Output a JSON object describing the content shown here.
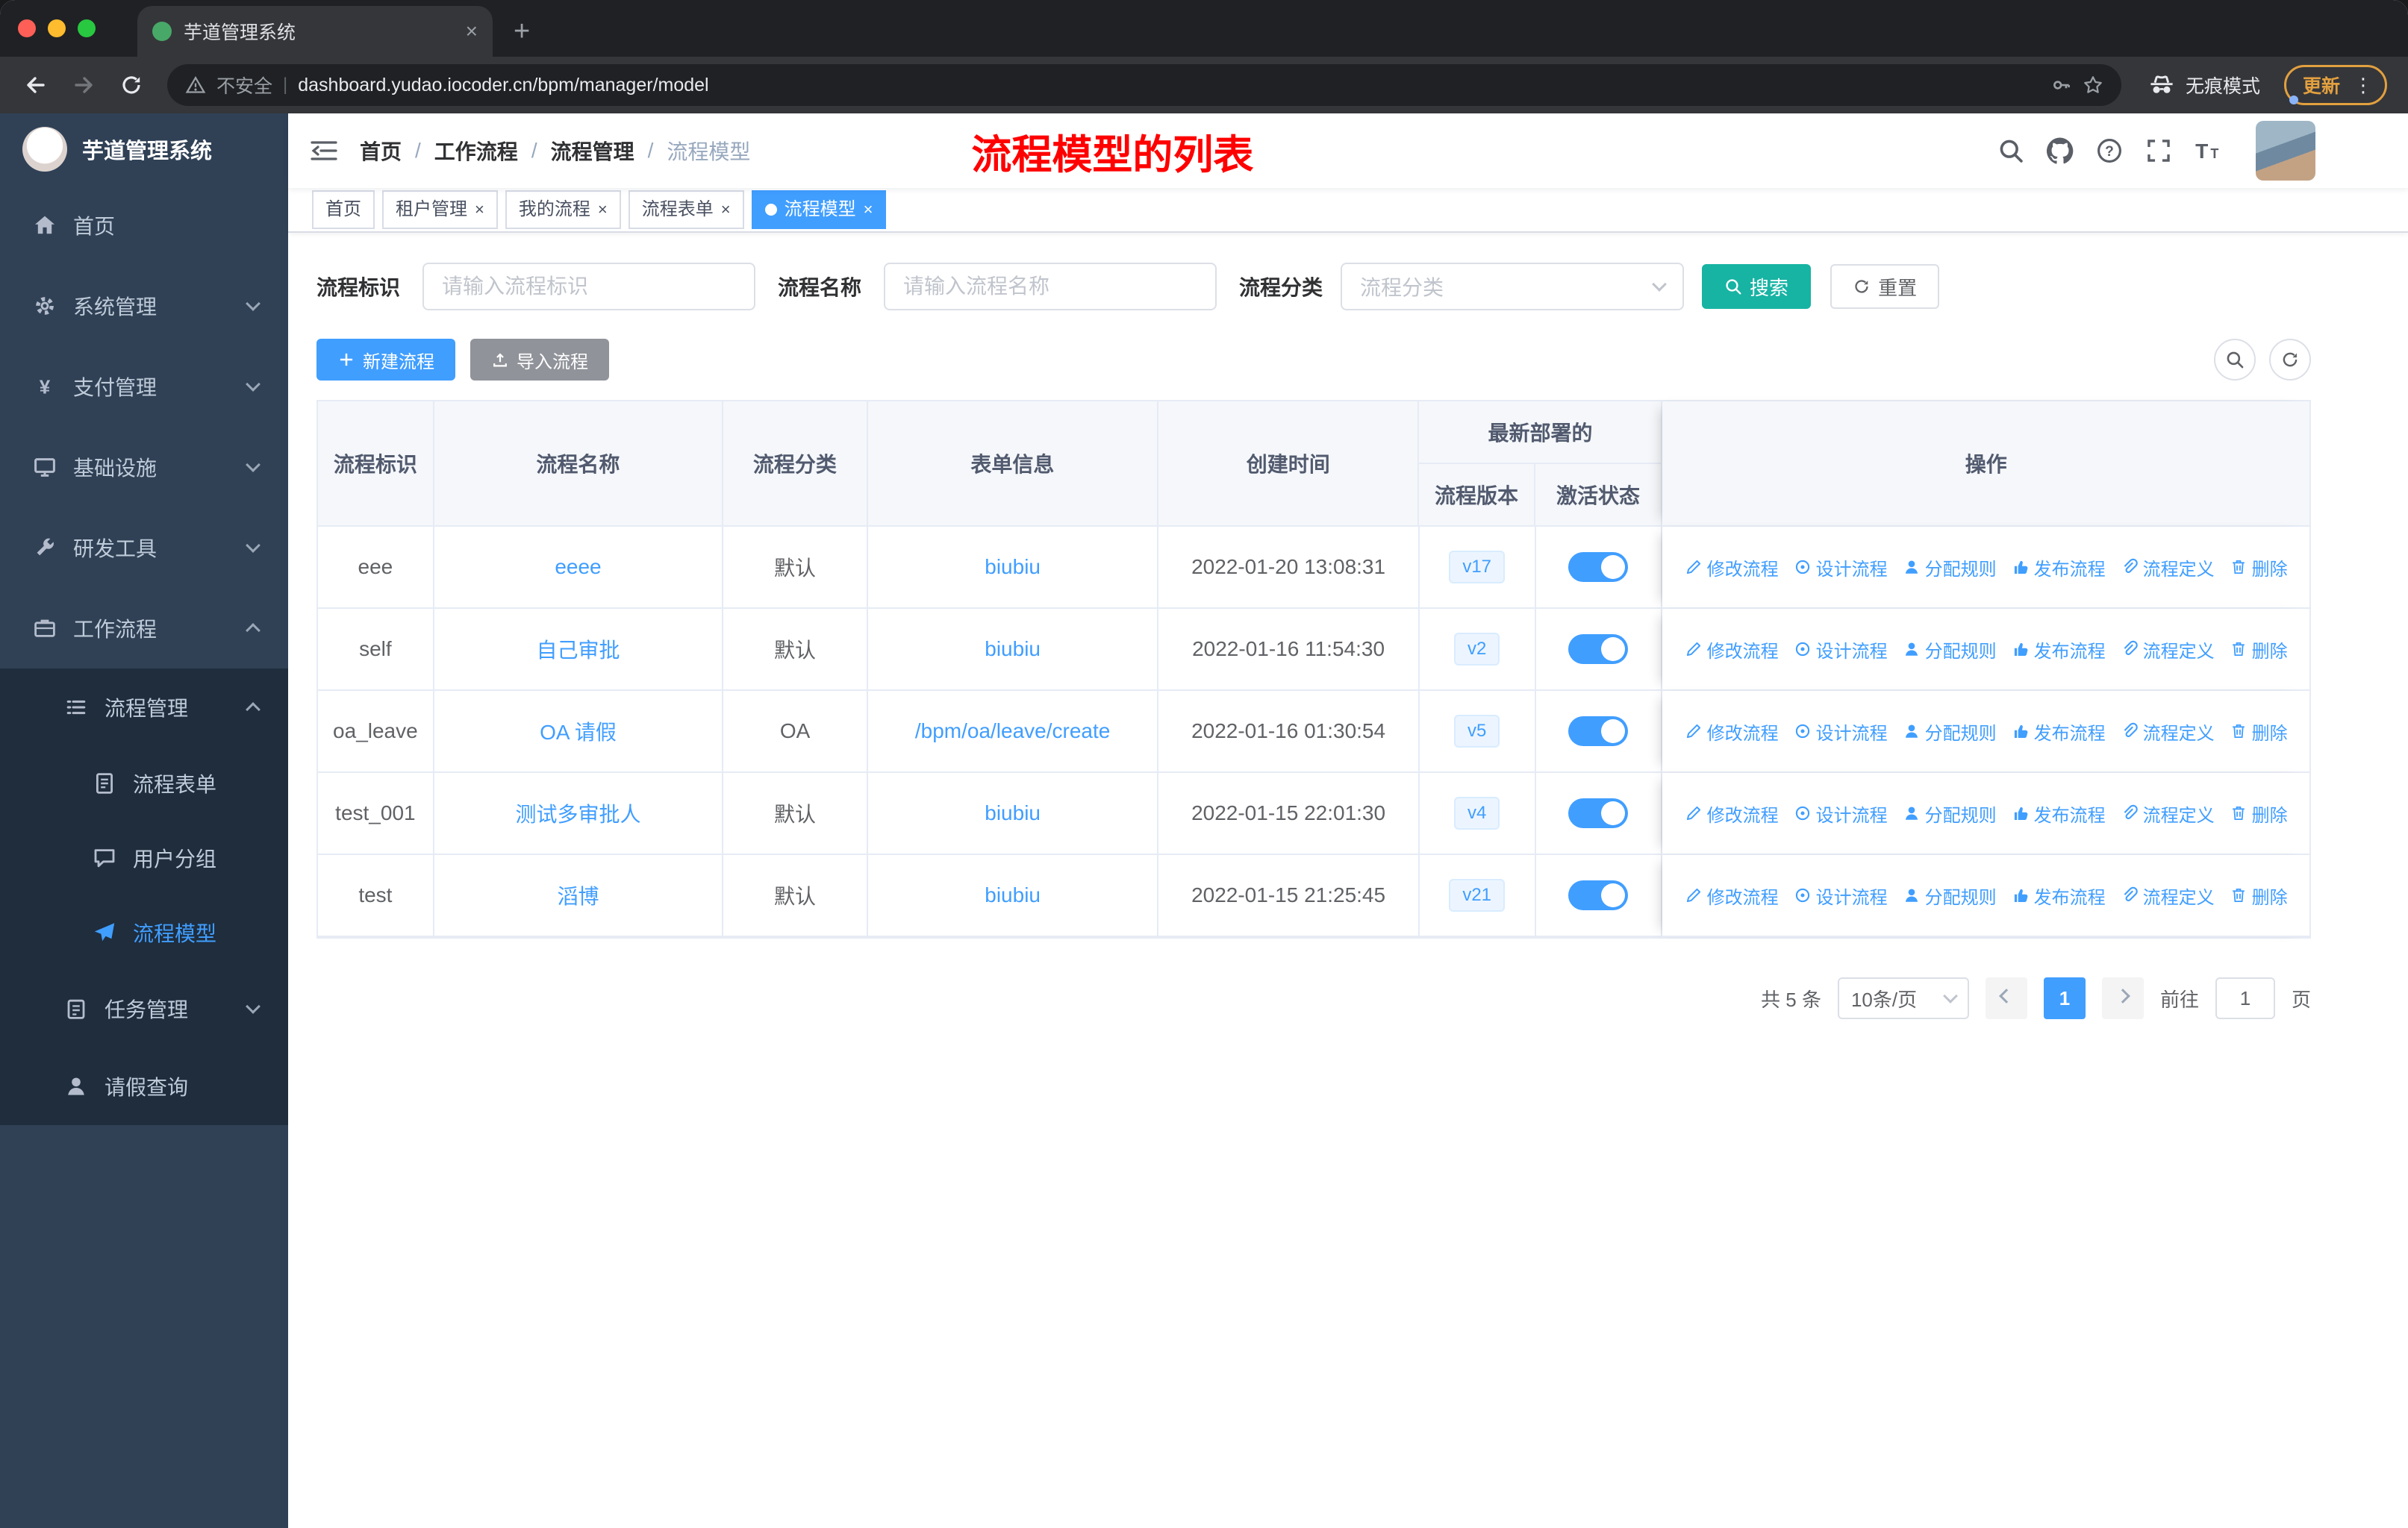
{
  "browser": {
    "tab_title": "芋道管理系统",
    "security_label": "不安全",
    "url": "dashboard.yudao.iocoder.cn/bpm/manager/model",
    "incognito_label": "无痕模式",
    "update_label": "更新"
  },
  "sidebar": {
    "title": "芋道管理系统",
    "items": [
      {
        "label": "首页",
        "icon": "home-icon"
      },
      {
        "label": "系统管理",
        "icon": "gear-icon"
      },
      {
        "label": "支付管理",
        "icon": "yen-icon"
      },
      {
        "label": "基础设施",
        "icon": "monitor-icon"
      },
      {
        "label": "研发工具",
        "icon": "wrench-icon"
      },
      {
        "label": "工作流程",
        "icon": "briefcase-icon"
      },
      {
        "label": "流程管理",
        "icon": "list-icon"
      },
      {
        "label": "流程表单",
        "icon": "document-icon"
      },
      {
        "label": "用户分组",
        "icon": "chat-icon"
      },
      {
        "label": "流程模型",
        "icon": "send-icon",
        "active": true
      },
      {
        "label": "任务管理",
        "icon": "clipboard-icon"
      },
      {
        "label": "请假查询",
        "icon": "user-icon"
      }
    ]
  },
  "navbar": {
    "breadcrumb": {
      "home": "首页",
      "l1": "工作流程",
      "l2": "流程管理",
      "current": "流程模型"
    },
    "annotation": "流程模型的列表"
  },
  "tags": [
    {
      "label": "首页"
    },
    {
      "label": "租户管理"
    },
    {
      "label": "我的流程"
    },
    {
      "label": "流程表单"
    },
    {
      "label": "流程模型"
    }
  ],
  "filters": {
    "key_label": "流程标识",
    "key_placeholder": "请输入流程标识",
    "name_label": "流程名称",
    "name_placeholder": "请输入流程名称",
    "category_label": "流程分类",
    "category_placeholder": "流程分类",
    "search": "搜索",
    "reset": "重置"
  },
  "toolbar": {
    "create": "新建流程",
    "import": "导入流程"
  },
  "table": {
    "headers": {
      "key": "流程标识",
      "name": "流程名称",
      "category": "流程分类",
      "form": "表单信息",
      "created": "创建时间",
      "deploy_group": "最新部署的",
      "version": "流程版本",
      "active": "激活状态",
      "actions": "操作"
    },
    "rows": [
      {
        "key": "eee",
        "name": "eeee",
        "category": "默认",
        "form": "biubiu",
        "created": "2022-01-20 13:08:31",
        "version": "v17",
        "active": true
      },
      {
        "key": "self",
        "name": "自己审批",
        "category": "默认",
        "form": "biubiu",
        "created": "2022-01-16 11:54:30",
        "version": "v2",
        "active": true
      },
      {
        "key": "oa_leave",
        "name": "OA 请假",
        "category": "OA",
        "form": "/bpm/oa/leave/create",
        "created": "2022-01-16 01:30:54",
        "version": "v5",
        "active": true
      },
      {
        "key": "test_001",
        "name": "测试多审批人",
        "category": "默认",
        "form": "biubiu",
        "created": "2022-01-15 22:01:30",
        "version": "v4",
        "active": true
      },
      {
        "key": "test",
        "name": "滔博",
        "category": "默认",
        "form": "biubiu",
        "created": "2022-01-15 21:25:45",
        "version": "v21",
        "active": true
      }
    ],
    "actions": [
      "修改流程",
      "设计流程",
      "分配规则",
      "发布流程",
      "流程定义",
      "删除"
    ]
  },
  "pagination": {
    "total": "共 5 条",
    "page_size": "10条/页",
    "page": "1",
    "goto": "前往",
    "goto_value": "1",
    "unit": "页"
  },
  "icons": {
    "search": "magnifier",
    "github": "octocat",
    "help": "question-circle",
    "fullscreen": "expand-corners",
    "font_size": "double-T",
    "create": "plus",
    "import": "upload-arrow",
    "refresh": "circular-arrow",
    "edit": "pencil",
    "design": "target",
    "assign": "person",
    "publish": "thumb-up",
    "definition": "paperclip",
    "delete": "trash"
  },
  "colors": {
    "accent": "#409EFF",
    "search_button": "#17B3A3",
    "import_button": "#909399",
    "sidebar_bg": "#304156",
    "submenu_bg": "#1F2D3D",
    "annotation_red": "#FF0000",
    "tag_bg": "#ECF5FF"
  }
}
